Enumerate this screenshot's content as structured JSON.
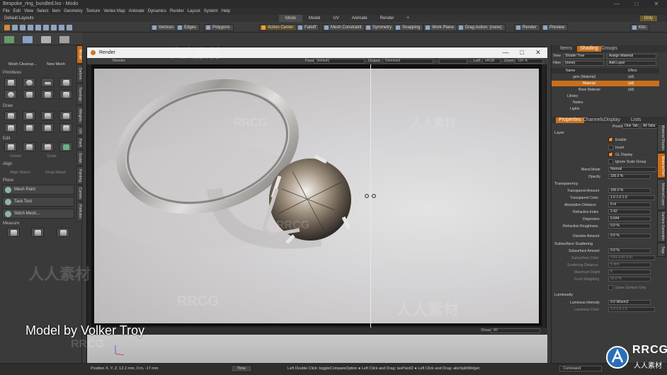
{
  "app": {
    "title": "Bespoke_ring_bundled.lxo - Modo",
    "layout": "Default Layouts"
  },
  "menu": [
    "File",
    "Edit",
    "View",
    "Select",
    "Item",
    "Geometry",
    "Texture",
    "Vertex Map",
    "Animate",
    "Dynamics",
    "Render",
    "Layout",
    "System",
    "Help"
  ],
  "layout_tabs": [
    "Mode",
    "Model",
    "UV",
    "Animate",
    "Render",
    "+"
  ],
  "only_label": "Only",
  "toolbar": {
    "vertices": "Vertices",
    "edges": "Edges",
    "polygons": "Polygons",
    "action_center": "Action Center",
    "falloff": "Falloff",
    "mesh_constraint": "Mesh Constraint",
    "symmetry": "Symmetry",
    "snapping": "Snapping",
    "work_plane": "Work Plane",
    "drag_action": "Drag Action: (none)",
    "render": "Render",
    "preview": "Preview",
    "kits": "Kits"
  },
  "leftpanel": {
    "top_buttons": [
      "Mesh Cleanup...",
      "New Mesh"
    ],
    "sections": [
      "Primitives",
      "Draw",
      "Edit",
      "Align",
      "Place",
      "Measure"
    ],
    "edit_labels": [
      "Center",
      "Scale"
    ],
    "align_labels": [
      "Align Match",
      "Snap Match"
    ],
    "place_items": [
      "Mesh Paint",
      "Tack Tool",
      "Stitch Mesh..."
    ],
    "vtabs": [
      "Model",
      "Deform",
      "Topology",
      "Weights",
      "UV",
      "Paint",
      "Sculpt",
      "Painting",
      "Curves",
      "Particles"
    ]
  },
  "render_window": {
    "title": "Render",
    "menu": "Render",
    "pass_label": "Pass",
    "pass_value": "(default)",
    "output_label": "Output",
    "output_value": "Denoised",
    "left_label": "Left",
    "left_value": "sRGB",
    "zoom_label": "Zoom",
    "zoom_value": "100 %",
    "show_label": "Show",
    "show_value": "All",
    "credit": "Model by Volker Troy"
  },
  "shader_panel": {
    "tabs": [
      "Items",
      "Shading",
      "Groups"
    ],
    "view_label": "View",
    "view_value": "Shader Tree",
    "assign_label": "Assign Material",
    "filter_label": "Filter",
    "filter_value": "(none)",
    "add_layer": "Add Layer",
    "col_name": "Name",
    "col_effect": "Effect",
    "rows": [
      {
        "name": "gem (Material)",
        "effect": "(all)"
      },
      {
        "name": "Material",
        "effect": "(all)"
      },
      {
        "name": "Base Material",
        "effect": "(all)"
      },
      {
        "name": "Library",
        "effect": ""
      },
      {
        "name": "Nodes",
        "effect": ""
      },
      {
        "name": "Lights",
        "effect": ""
      }
    ]
  },
  "properties": {
    "tabs": [
      "Properties",
      "Channels",
      "Display",
      "Lists"
    ],
    "presets_label": "Presets",
    "presets_value": "One Tab",
    "all_tabs": "All Tabs",
    "layer_section": "Layer",
    "layer_checks": [
      {
        "label": "Enable",
        "on": true
      },
      {
        "label": "Invert",
        "on": false
      },
      {
        "label": "GL Display",
        "on": true
      },
      {
        "label": "Ignore Scale Group",
        "on": false
      }
    ],
    "blend_mode_label": "Blend Mode",
    "blend_mode": "Normal",
    "opacity_label": "Opacity",
    "opacity": "100.0 %",
    "transparency_section": "Transparency",
    "transparency": [
      {
        "label": "Transparent Amount",
        "value": "100.0 %"
      },
      {
        "label": "Transparent Color",
        "value": "1.0   1.0   1.0"
      },
      {
        "label": "Absorption Distance",
        "value": "0 m"
      },
      {
        "label": "Refractive Index",
        "value": "2.42"
      },
      {
        "label": "Dispersion",
        "value": "0.044"
      },
      {
        "label": "Refraction Roughness",
        "value": "0.0 %"
      },
      {
        "label": "Dissolve Amount",
        "value": "0.0 %"
      }
    ],
    "subsurface_section": "Subsurface Scattering",
    "subsurface": [
      {
        "label": "Subsurface Amount",
        "value": "0.0 %"
      },
      {
        "label": "Subsurface Color",
        "value": "0.81  0.81  0.81"
      },
      {
        "label": "Scattering Distance",
        "value": "5 mm"
      },
      {
        "label": "Maximum Depth",
        "value": "8"
      },
      {
        "label": "Front Weighting",
        "value": "20.0 %"
      },
      {
        "label": "Same Surface Only",
        "value": ""
      }
    ],
    "luminosity_section": "Luminosity",
    "luminosity": [
      {
        "label": "Luminous Intensity",
        "value": "0.0 W/srm2"
      },
      {
        "label": "Luminous Color",
        "value": "1.0   1.0   1.0"
      }
    ],
    "rvtabs": [
      "Material Shader",
      "Material Ref",
      "Material Layer",
      "Surface Generator",
      "Tags"
    ]
  },
  "status": {
    "position": "Position X, Y, Z:   12.2 mm, 0 m, -17 mm",
    "time": "Time",
    "hint": "Left Double Click: toggleCompareOption  ● Left Click and Drag: taxPan02  ● Left Click and Drag: aboSplitWidget",
    "command": "Command"
  },
  "watermarks": {
    "cn": "人人素材",
    "en": "RRCG"
  },
  "logo": {
    "main": "RRCG",
    "sub": "人人素材"
  },
  "colors": {
    "accent": "#c86f1c",
    "bg": "#3a3a3a",
    "render_bg": "#d5d4d6"
  }
}
